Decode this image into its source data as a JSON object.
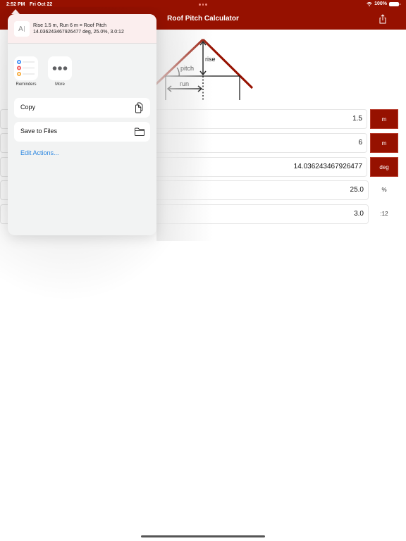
{
  "status_bar": {
    "time": "2:52 PM",
    "date": "Fri Oct 22",
    "battery": "100%"
  },
  "nav": {
    "title": "Roof Pitch Calculator",
    "share_icon": "share-icon"
  },
  "diagram": {
    "labels": {
      "rise": "rise",
      "pitch": "pitch",
      "run": "run"
    },
    "roof_color": "#961100"
  },
  "fields": [
    {
      "name": "rise",
      "value": "1.5",
      "unit": "m",
      "unit_is_button": true
    },
    {
      "name": "run",
      "value": "6",
      "unit": "m",
      "unit_is_button": true
    },
    {
      "name": "pitch-angle",
      "value": "14.036243467926477",
      "unit": "deg",
      "unit_is_button": true
    },
    {
      "name": "pitch-percent",
      "value": "25.0",
      "unit": "%",
      "unit_is_button": false
    },
    {
      "name": "pitch-ratio",
      "value": "3.0",
      "unit": ":12",
      "unit_is_button": false
    }
  ],
  "share_sheet": {
    "preview_icon": "text-cursor-icon",
    "preview_glyph": "A𝙸",
    "preview_line1": "Rise 1.5 m, Run 6 m = Roof Pitch",
    "preview_line2": "14.036243467926477 deg, 25.0%, 3.0:12",
    "apps": [
      {
        "label": "Reminders",
        "icon": "reminders-icon"
      },
      {
        "label": "More",
        "icon": "more-icon"
      }
    ],
    "actions": [
      {
        "label": "Copy",
        "icon": "copy-icon"
      },
      {
        "label": "Save to Files",
        "icon": "folder-icon"
      }
    ],
    "edit_actions_label": "Edit Actions..."
  },
  "colors": {
    "accent": "#961100",
    "link": "#2b86e0",
    "sheet_bg": "#f2f3f3",
    "sheet_header_bg": "#fbeeee"
  }
}
